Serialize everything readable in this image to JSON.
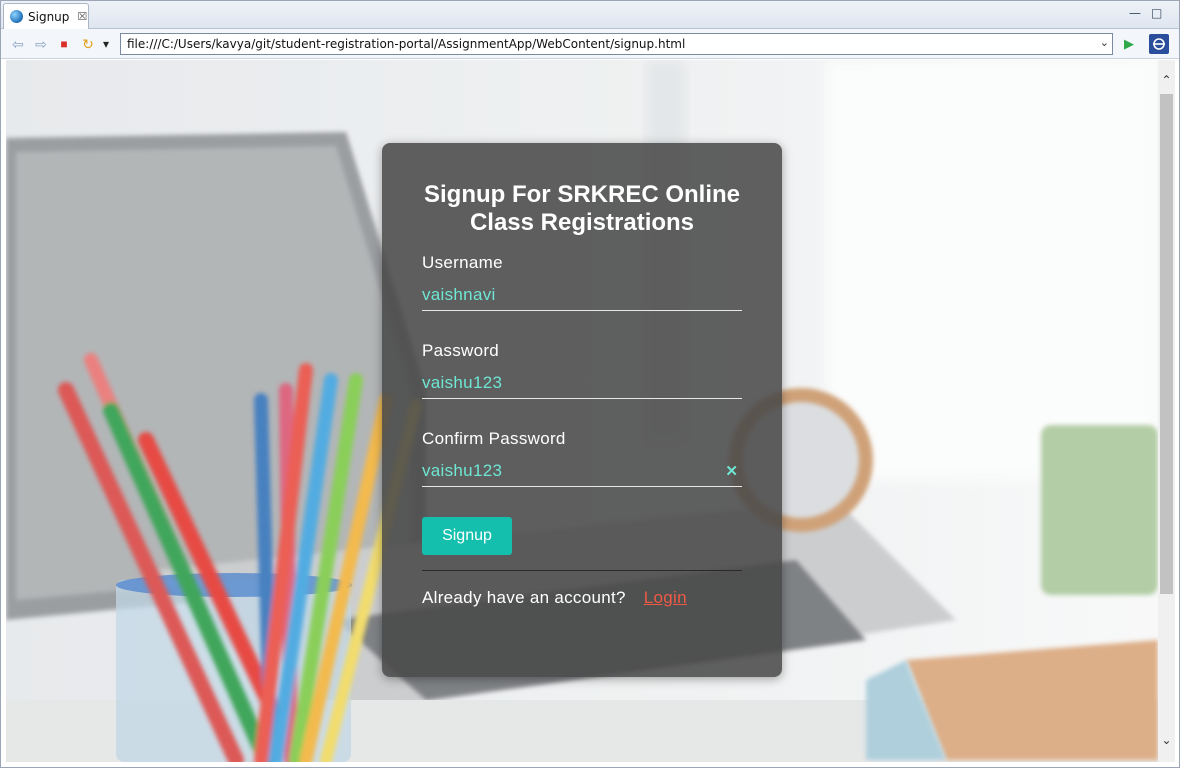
{
  "browser": {
    "tab_title": "Signup",
    "tab_close": "☒",
    "url": "file:///C:/Users/kavya/git/student-registration-portal/AssignmentApp/WebContent/signup.html",
    "minimize": "—",
    "maximize": "□",
    "nav": {
      "back": "⇦",
      "forward": "⇨",
      "stop": "■",
      "refresh": "↻",
      "menu": "▾",
      "go": "▶",
      "url_dropdown": "⌄"
    },
    "scroll_up": "⌃",
    "scroll_down": "⌄"
  },
  "signup_form": {
    "title": "Signup For SRKREC Online Class Registrations",
    "username_label": "Username",
    "username_value": "vaishnavi",
    "password_label": "Password",
    "password_value": "vaishu123",
    "confirm_label": "Confirm Password",
    "confirm_value": "vaishu123",
    "clear_icon": "✕",
    "submit_label": "Signup",
    "already_text": "Already have an account?",
    "login_link": "Login"
  },
  "colors": {
    "accent_button": "#14bfae",
    "input_text": "#6fe6d4",
    "login_link": "#ef5a45",
    "card_background": "rgba(72,72,72,0.87)"
  }
}
